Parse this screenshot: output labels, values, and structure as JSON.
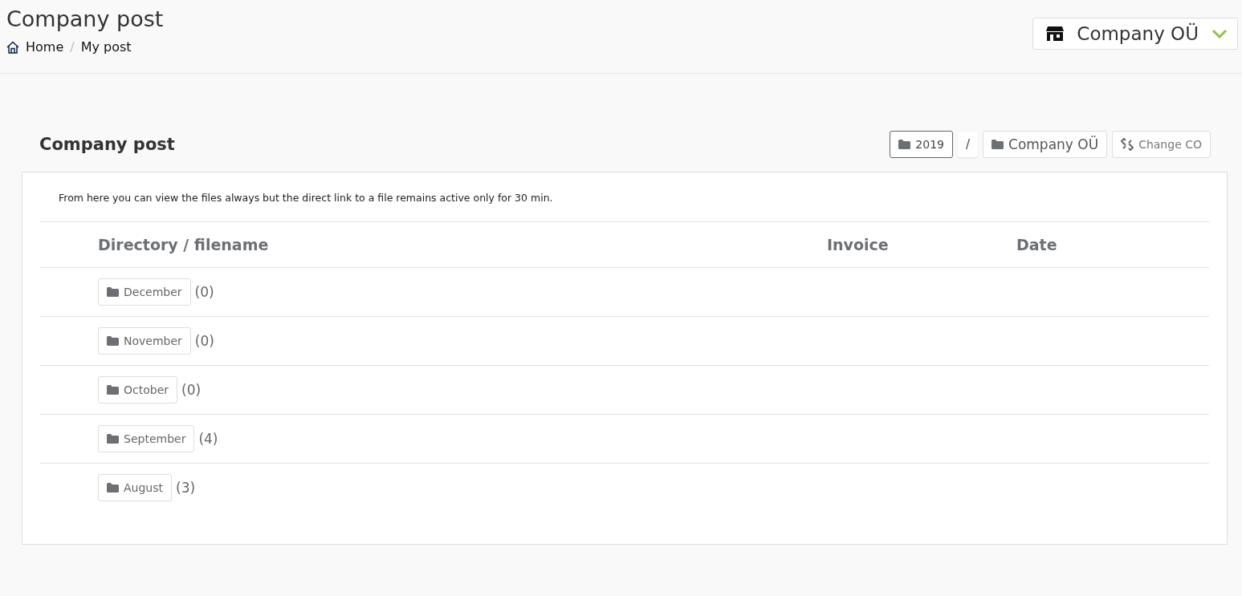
{
  "page_header": {
    "title": "Company post",
    "breadcrumb": [
      "Home",
      "My post"
    ],
    "breadcrumb_separator": "/",
    "company_selector": "Company OÜ"
  },
  "card": {
    "title": "Company post",
    "path": [
      {
        "label": "2019",
        "selected": true
      },
      {
        "label": "Company OÜ",
        "selected": false
      }
    ],
    "separator": "/",
    "change_button": "Change CO",
    "notice": "From here you can view the files always but the direct link to a file remains active only for 30 min.",
    "table": {
      "columns": [
        "Directory / filename",
        "Invoice",
        "Date"
      ],
      "rows": [
        {
          "folder": "December",
          "count": "(0)"
        },
        {
          "folder": "November",
          "count": "(0)"
        },
        {
          "folder": "October",
          "count": "(0)"
        },
        {
          "folder": "September",
          "count": "(4)"
        },
        {
          "folder": "August",
          "count": "(3)"
        }
      ]
    }
  }
}
